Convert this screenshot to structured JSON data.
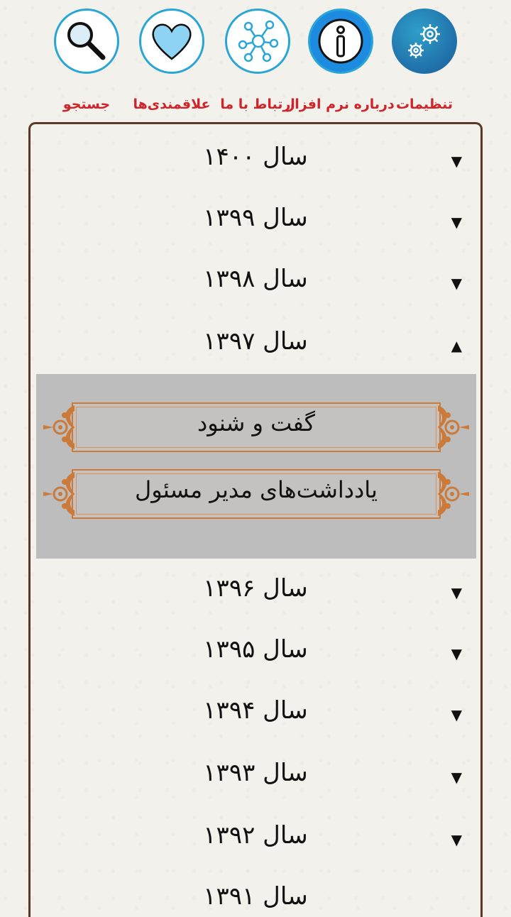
{
  "toolbar": {
    "items": [
      {
        "label": "تنظیمات",
        "icon": "settings-gears-icon"
      },
      {
        "label": "درباره نرم افزار",
        "icon": "info-icon"
      },
      {
        "label": "ارتباط با ما",
        "icon": "network-share-icon"
      },
      {
        "label": "علاقمندی‌ها",
        "icon": "heart-icon"
      },
      {
        "label": "جستجو",
        "icon": "magnifier-icon"
      }
    ]
  },
  "years": [
    {
      "label": "سال ۱۴۰۰",
      "arrow": "▼"
    },
    {
      "label": "سال ۱۳۹۹",
      "arrow": "▼"
    },
    {
      "label": "سال ۱۳۹۸",
      "arrow": "▼"
    },
    {
      "label": "سال ۱۳۹۷",
      "arrow": "▲"
    },
    {
      "label": "سال ۱۳۹۶",
      "arrow": "▼"
    },
    {
      "label": "سال ۱۳۹۵",
      "arrow": "▼"
    },
    {
      "label": "سال ۱۳۹۴",
      "arrow": "▼"
    },
    {
      "label": "سال ۱۳۹۳",
      "arrow": "▼"
    },
    {
      "label": "سال ۱۳۹۲",
      "arrow": "▼"
    },
    {
      "label": "سال ۱۳۹۱",
      "arrow": ""
    }
  ],
  "submenu": {
    "items": [
      {
        "label": "گفت و شنود"
      },
      {
        "label": "یادداشت‌های مدیر مسئول"
      }
    ]
  },
  "colors": {
    "accent_blue": "#2aa6d6",
    "label_red": "#d0232a",
    "frame_brown": "#5a3826",
    "submenu_gray": "#bdbdbd",
    "ornament_orange": "#cc7a3a"
  }
}
